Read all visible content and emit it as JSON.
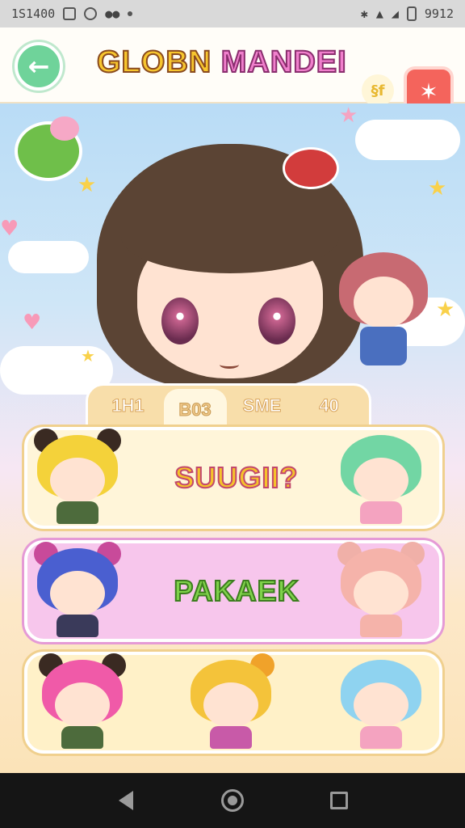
{
  "status_bar": {
    "time": "1S1400",
    "right_time": "9912"
  },
  "header": {
    "title_part1": "GLOBN",
    "title_part2": "MANDEI",
    "badge": "§f",
    "back_icon": "←",
    "share_icon": "✶"
  },
  "tabs": [
    {
      "label": "1H1",
      "active": false
    },
    {
      "label": "B03",
      "active": true
    },
    {
      "label": "SME",
      "active": false
    },
    {
      "label": "40",
      "active": false
    }
  ],
  "cards": [
    {
      "label": "SUUGII?"
    },
    {
      "label": "PAKAEK"
    },
    {
      "label": ""
    }
  ],
  "colors": {
    "accent_green": "#6fd39a",
    "accent_red": "#f4645c",
    "title_yellow": "#f7c62e",
    "title_pink": "#f07fcc"
  }
}
